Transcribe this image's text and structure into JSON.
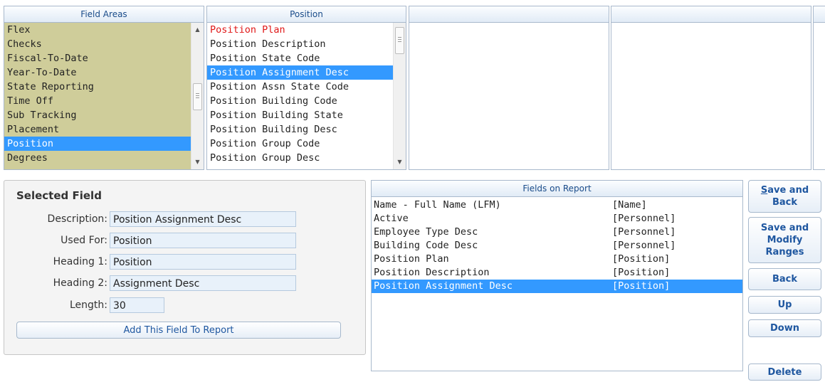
{
  "field_areas": {
    "header": "Field Areas",
    "items": [
      "Flex",
      "Checks",
      "Fiscal-To-Date",
      "Year-To-Date",
      "State Reporting",
      "Time Off",
      "Sub Tracking",
      "Placement",
      "Position",
      "Degrees"
    ],
    "selected_index": 8
  },
  "position_list": {
    "header": "Position",
    "items": [
      "Position Plan",
      "Position Description",
      "Position State Code",
      "Position Assignment Desc",
      "Position Assn State Code",
      "Position Building Code",
      "Position Building State",
      "Position Building Desc",
      "Position Group Code",
      "Position Group Desc"
    ],
    "selected_index": 3,
    "highlighted_red_index": 0
  },
  "selected_field": {
    "title": "Selected Field",
    "description_label": "Description:",
    "description_value": "Position Assignment Desc",
    "used_for_label": "Used For:",
    "used_for_value": "Position",
    "heading1_label": "Heading 1:",
    "heading1_value": "Position",
    "heading2_label": "Heading 2:",
    "heading2_value": "Assignment Desc",
    "length_label": "Length:",
    "length_value": "30",
    "add_button": "Add This Field To Report"
  },
  "fields_on_report": {
    "header": "Fields on Report",
    "rows": [
      {
        "field": "Name - Full Name (LFM)",
        "area": "[Name]"
      },
      {
        "field": "Active",
        "area": "[Personnel]"
      },
      {
        "field": "Employee Type Desc",
        "area": "[Personnel]"
      },
      {
        "field": "Building Code Desc",
        "area": "[Personnel]"
      },
      {
        "field": "Position Plan",
        "area": "[Position]"
      },
      {
        "field": "Position Description",
        "area": "[Position]"
      },
      {
        "field": "Position Assignment Desc",
        "area": "[Position]"
      }
    ],
    "selected_index": 6
  },
  "buttons": {
    "save_and_back_first": "S",
    "save_and_back_rest": "ave and",
    "save_and_back_line2": "Back",
    "save_modify_line1": "Save and",
    "save_modify_line2": "Modify",
    "save_modify_line3": "Ranges",
    "back": "Back",
    "up": "Up",
    "down": "Down",
    "delete": "Delete"
  },
  "colors": {
    "field_area_bg": "#cfcd9a",
    "selection": "#3399ff",
    "button_text": "#1f57a0"
  }
}
